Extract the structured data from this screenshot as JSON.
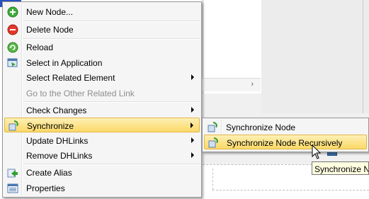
{
  "menu": {
    "items": [
      {
        "label": "New Node...",
        "icon": "add-icon"
      },
      {
        "label": "Delete Node",
        "icon": "delete-icon"
      },
      {
        "label": "Reload",
        "icon": "reload-icon"
      },
      {
        "label": "Select in Application",
        "icon": "select-in-app-icon"
      },
      {
        "label": "Select Related Element",
        "submenu": true
      },
      {
        "label": "Go to the Other Related Link",
        "disabled": true
      },
      {
        "label": "Check Changes",
        "submenu": true
      },
      {
        "label": "Synchronize",
        "icon": "synchronize-icon",
        "submenu": true,
        "highlighted": true
      },
      {
        "label": "Update DHLinks",
        "submenu": true
      },
      {
        "label": "Remove DHLinks",
        "submenu": true
      },
      {
        "label": "Create Alias",
        "icon": "create-alias-icon"
      },
      {
        "label": "Properties",
        "icon": "properties-icon"
      }
    ]
  },
  "submenu": {
    "items": [
      {
        "label": "Synchronize Node",
        "icon": "synchronize-icon"
      },
      {
        "label": "Synchronize Node Recursively",
        "icon": "synchronize-icon",
        "highlighted": true
      }
    ]
  },
  "tooltip": {
    "text": "Synchronize N"
  },
  "colors": {
    "highlight_top": "#fdf0b6",
    "highlight_bottom": "#fbd967",
    "highlight_border": "#e3b54a",
    "menu_bg": "#f5f5f5",
    "tooltip_bg": "#ffffe1"
  }
}
